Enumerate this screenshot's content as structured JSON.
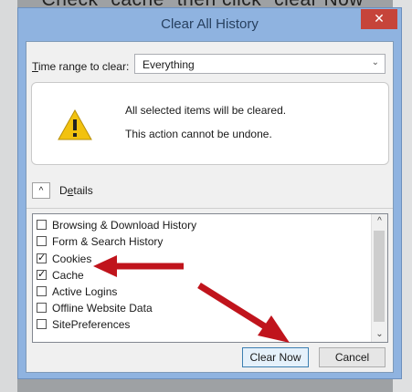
{
  "caption": "Check “cache” then click “clear Now”",
  "dialog": {
    "title": "Clear All History",
    "close_glyph": "✕",
    "time_range": {
      "label_prefix": "T",
      "label_rest": "ime range to clear:",
      "value": "Everything",
      "chevron": "⌄"
    },
    "warning": {
      "icon": "warning-icon",
      "line1": "All selected items will be cleared.",
      "line2": "This action cannot be undone."
    },
    "details": {
      "toggle_glyph": "^",
      "label_prefix": "D",
      "label_underlined": "e",
      "label_rest": "tails"
    },
    "items": [
      {
        "label": "Browsing & Download History",
        "checked": false
      },
      {
        "label": "Form & Search History",
        "checked": false
      },
      {
        "label": "Cookies",
        "checked": true
      },
      {
        "label": "Cache",
        "checked": true
      },
      {
        "label": "Active Logins",
        "checked": false
      },
      {
        "label": "Offline Website Data",
        "checked": false
      },
      {
        "label": "SitePreferences",
        "checked": false
      }
    ],
    "scroll_up": "^",
    "scroll_down": "⌄",
    "buttons": {
      "clear_now": "Clear Now",
      "cancel": "Cancel"
    }
  },
  "colors": {
    "annotation_arrow": "#c0141c",
    "title_bar": "#8fb3e0",
    "close_button": "#c6443a"
  }
}
